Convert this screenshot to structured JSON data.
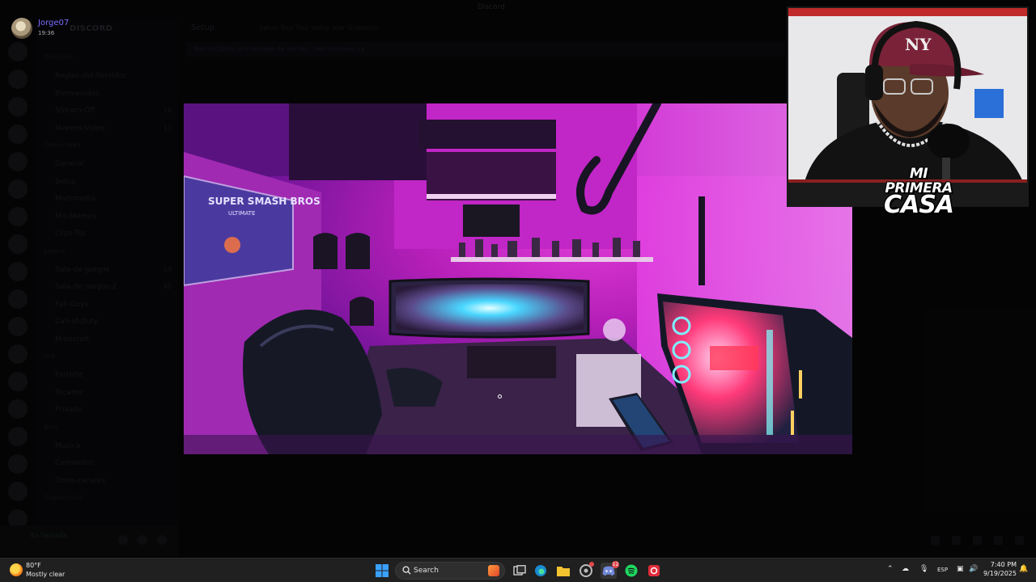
{
  "window": {
    "title": "Discord"
  },
  "user_badge": {
    "name": "Jorge07",
    "time": "19:36"
  },
  "discord_bg": {
    "server_name": "DISCORD",
    "header_channel": "Setup",
    "header_topic": "Setup Tour Tour Setup tour Grabando",
    "banner": "Has recibido un mensaje de ventas · Ver mensaje ya",
    "channels": [
      {
        "label": "Anuncios",
        "category": true
      },
      {
        "label": "Reglas-del-Servidor",
        "category": false
      },
      {
        "label": "Bienvenidos",
        "category": false
      },
      {
        "label": "Stream-Off",
        "category": false,
        "count": "18"
      },
      {
        "label": "Nuevos-Video",
        "category": false,
        "count": "13"
      },
      {
        "label": "Comunidad",
        "category": true
      },
      {
        "label": "General",
        "category": false
      },
      {
        "label": "Setup",
        "category": false
      },
      {
        "label": "Multimedia",
        "category": false
      },
      {
        "label": "Mis-Memes",
        "category": false
      },
      {
        "label": "Clips-Tip",
        "category": false
      },
      {
        "label": "Juegos",
        "category": true
      },
      {
        "label": "Sala-de-Juegos",
        "category": false,
        "count": "23"
      },
      {
        "label": "Sala-de-Juegos-2",
        "category": false,
        "count": "45"
      },
      {
        "label": "Fall-Guys",
        "category": false
      },
      {
        "label": "Call-of-Duty",
        "category": false
      },
      {
        "label": "Minecraft",
        "category": false
      },
      {
        "label": "Voz",
        "category": true
      },
      {
        "label": "Fortnite",
        "category": false
      },
      {
        "label": "Tocame",
        "category": false
      },
      {
        "label": "Privado",
        "category": false
      },
      {
        "label": "Bots",
        "category": true
      },
      {
        "label": "Musica",
        "category": false
      },
      {
        "label": "Comandos",
        "category": false
      },
      {
        "label": "Otros-canales",
        "category": false
      },
      {
        "label": "Sugerencias",
        "category": true
      }
    ],
    "voice_status": "En llamada"
  },
  "video": {
    "poster_title": "SUPER SMASH BROS",
    "poster_subtitle": "ULTIMATE"
  },
  "webcam": {
    "overlay_line1": "MI PRIMERA",
    "overlay_line2": "CASA",
    "cap_logo": "NY"
  },
  "taskbar": {
    "weather_temp": "80°F",
    "weather_desc": "Mostly clear",
    "search_label": "Search",
    "language": "ESP",
    "clock_time": "7:40 PM",
    "clock_date": "9/19/2025",
    "discord_badge": "12"
  },
  "colors": {
    "accent_username": "#7b6cff",
    "taskbar_bg": "#202020",
    "video_magenta": "#e23bd8"
  }
}
